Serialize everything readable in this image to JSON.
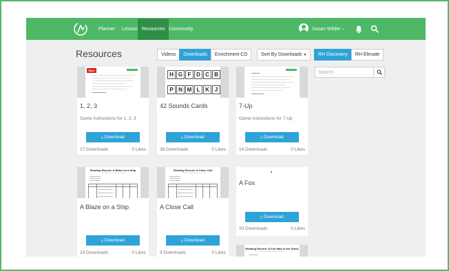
{
  "nav": {
    "items": [
      {
        "label": "Planner"
      },
      {
        "label": "Lessons"
      },
      {
        "label": "Resources"
      },
      {
        "label": "Community"
      }
    ],
    "user_name": "Susan Wilder",
    "user_caret": "⌄"
  },
  "page": {
    "title": "Resources"
  },
  "tabs": [
    {
      "label": "Videos"
    },
    {
      "label": "Downloads"
    },
    {
      "label": "Enrichment CD"
    }
  ],
  "sort": {
    "label": "Sort By Downloads"
  },
  "programs": [
    {
      "label": "RH Discovery"
    },
    {
      "label": "RH Elevate"
    }
  ],
  "search": {
    "placeholder": "Search"
  },
  "download_label": "Download",
  "cards": [
    {
      "title": "1, 2, 3",
      "desc": "Game instructions for 1, 2, 3",
      "downloads": "17 Downloads",
      "likes": "0 Likes",
      "badge": "Save"
    },
    {
      "title": "42 Sounds Cards",
      "desc": "",
      "downloads": "38 Downloads",
      "likes": "0 Likes",
      "letters_row1": [
        "H",
        "G",
        "F",
        "D",
        "C",
        "B"
      ],
      "letters_row2": [
        "P",
        "N",
        "M",
        "L",
        "K",
        "J"
      ]
    },
    {
      "title": "7-Up",
      "desc": "Game instructions for 7-Up",
      "downloads": "14 Downloads",
      "likes": "0 Likes"
    },
    {
      "title": "A Blaze on a Ship",
      "desc": "",
      "downloads": "19 Downloads",
      "likes": "0 Likes",
      "doc_heading": "Reading Record: A Blaze on a Ship"
    },
    {
      "title": "A Close Call",
      "desc": "",
      "downloads": "9 Downloads",
      "likes": "0 Likes",
      "doc_heading": "Reading Record: A Close Call"
    },
    {
      "title": "A Fox",
      "desc": "",
      "downloads": "20 Downloads",
      "likes": "0 Likes",
      "doc_heading": "Reading Record: A Fox Was in the Grass"
    }
  ],
  "colors": {
    "brand_green": "#4db866",
    "accent_blue": "#2ea3d8",
    "active_nav": "#2f8f48"
  }
}
